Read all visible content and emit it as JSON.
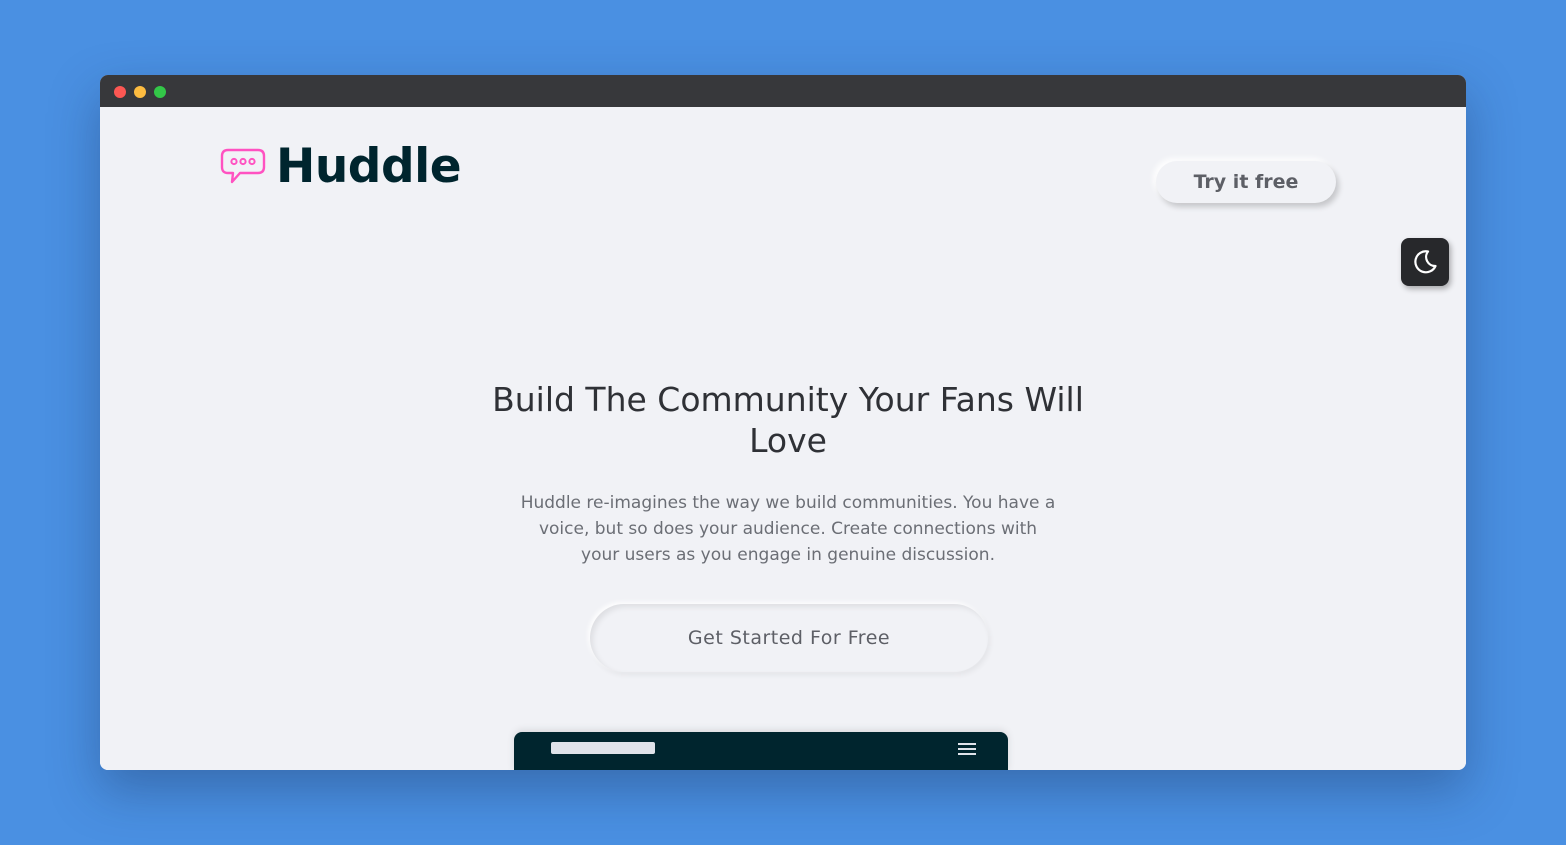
{
  "window": {
    "controls": [
      "close",
      "minimize",
      "maximize"
    ],
    "colors": {
      "close": "#fc5753",
      "minimize": "#fdbc40",
      "maximize": "#33c748"
    }
  },
  "header": {
    "logo_text": "Huddle",
    "logo_icon": "chat-bubble-icon",
    "try_label": "Try it free"
  },
  "theme_toggle": {
    "icon": "moon-icon"
  },
  "hero": {
    "title": "Build The Community Your Fans Will Love",
    "description": "Huddle re-imagines the way we build communities. You have a voice, but so does your audience. Create connections with your users as you engage in genuine discussion.",
    "cta_label": "Get Started For Free"
  },
  "mockup": {
    "menu_icon": "hamburger-menu-icon"
  },
  "colors": {
    "background": "#f1f2f6",
    "brand_dark": "#00252e",
    "accent_pink": "#ff52c1",
    "text_dark": "#2f3136",
    "text_muted": "#6b6e75"
  }
}
